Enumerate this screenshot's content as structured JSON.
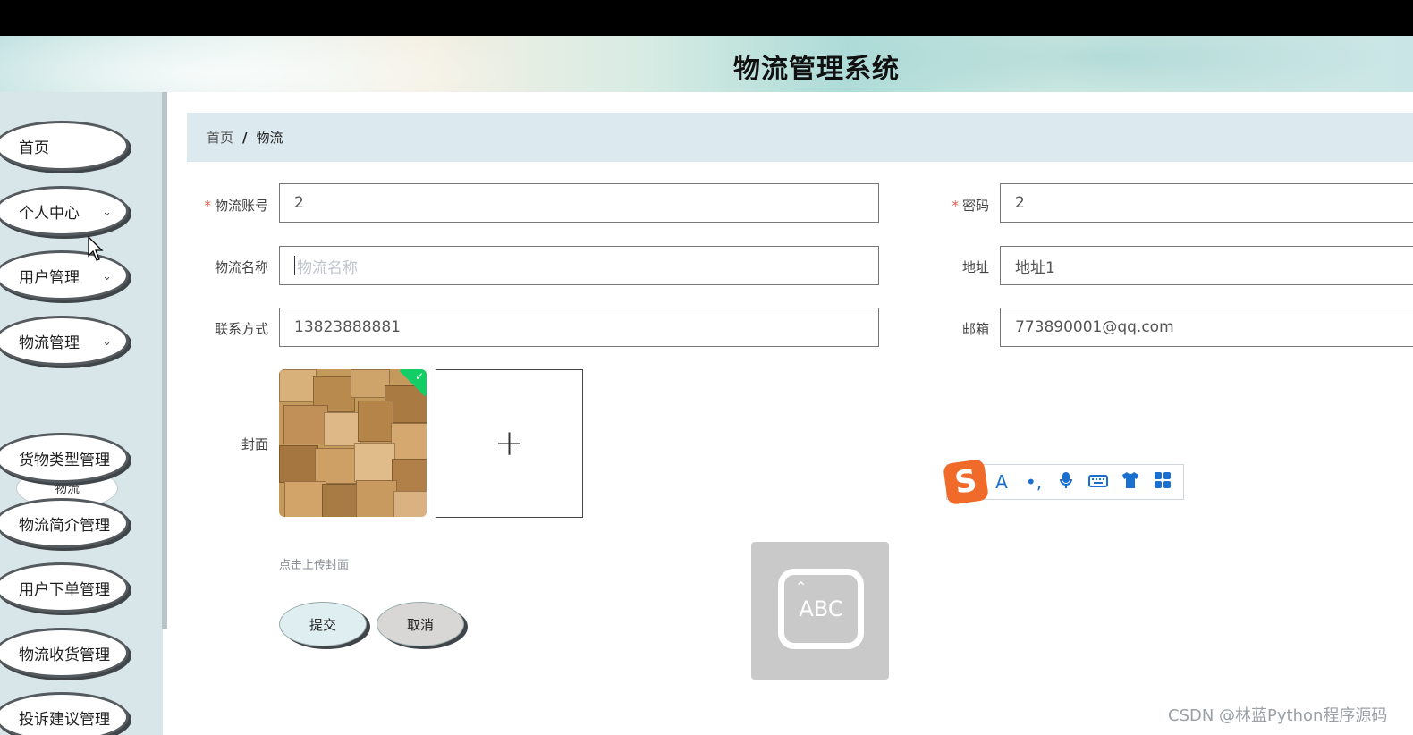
{
  "header": {
    "title": "物流管理系统"
  },
  "sidebar": {
    "items": [
      {
        "label": "首页",
        "has_chevron": false
      },
      {
        "label": "个人中心",
        "has_chevron": true
      },
      {
        "label": "用户管理",
        "has_chevron": true
      },
      {
        "label": "物流管理",
        "has_chevron": true
      },
      {
        "label": "货物类型管理",
        "has_chevron": true
      },
      {
        "label": "物流简介管理",
        "has_chevron": true
      },
      {
        "label": "用户下单管理",
        "has_chevron": true
      },
      {
        "label": "物流收货管理",
        "has_chevron": true
      },
      {
        "label": "投诉建议管理",
        "has_chevron": true
      }
    ],
    "submenu": {
      "label": "物流"
    }
  },
  "breadcrumb": {
    "home": "首页",
    "separator": "/",
    "current": "物流"
  },
  "form": {
    "account": {
      "label": "物流账号",
      "required": true,
      "value": "2"
    },
    "password": {
      "label": "密码",
      "required": true,
      "value": "2"
    },
    "name": {
      "label": "物流名称",
      "value": "",
      "placeholder": "物流名称"
    },
    "address": {
      "label": "地址",
      "value": "地址1"
    },
    "contact": {
      "label": "联系方式",
      "value": "13823888881"
    },
    "email": {
      "label": "邮箱",
      "value": "773890001@qq.com"
    },
    "cover": {
      "label": "封面",
      "hint": "点击上传封面",
      "uploaded": true
    }
  },
  "buttons": {
    "submit": "提交",
    "cancel": "取消"
  },
  "ime": {
    "abc_text": "ABC"
  },
  "watermark": "CSDN @林蓝Python程序源码",
  "colors": {
    "required": "#e05a50",
    "success": "#13ce66",
    "breadcrumb_bg": "#dce9ef",
    "sidebar_bg": "#d8e6ea"
  }
}
